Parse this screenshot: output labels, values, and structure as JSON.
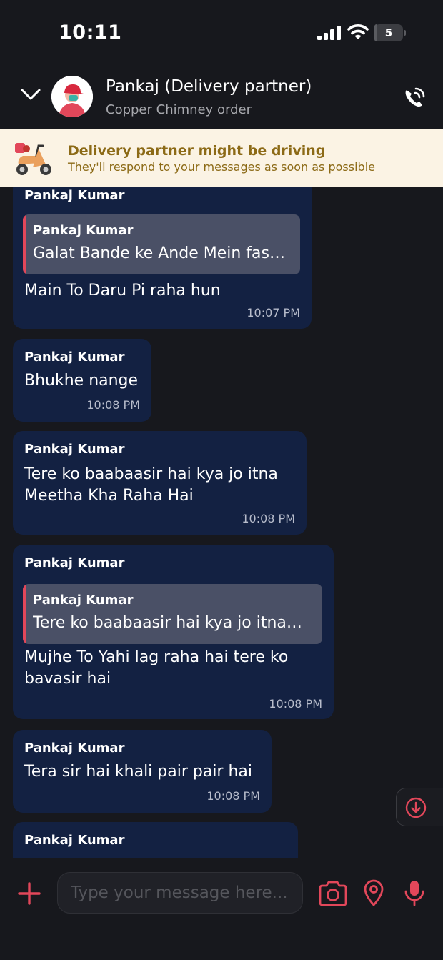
{
  "status_bar": {
    "time": "10:11",
    "battery": "5",
    "battery_level": 0.05
  },
  "header": {
    "contact_name": "Pankaj (Delivery partner)",
    "subtitle": "Copper Chimney order"
  },
  "banner": {
    "title": "Delivery partner might be driving",
    "subtitle": "They'll respond to your messages as soon as possible"
  },
  "messages": [
    {
      "sender": "Pankaj Kumar",
      "quote": {
        "sender": "Pankaj Kumar",
        "text": "Galat Bande ke Ande Mein fas…"
      },
      "text": "Main To Daru Pi raha hun",
      "time": "10:07 PM"
    },
    {
      "sender": "Pankaj Kumar",
      "text": "Bhukhe nange",
      "time": "10:08 PM"
    },
    {
      "sender": "Pankaj Kumar",
      "text": "Tere ko baabaasir hai kya jo itna Meetha Kha Raha Hai",
      "time": "10:08 PM"
    },
    {
      "sender": "Pankaj Kumar",
      "quote": {
        "sender": "Pankaj Kumar",
        "text": "Tere ko baabaasir hai kya jo itna…"
      },
      "text": "Mujhe To Yahi lag raha hai tere ko bavasir hai",
      "time": "10:08 PM"
    },
    {
      "sender": "Pankaj Kumar",
      "text": "Tera sir hai khali pair pair hai",
      "time": "10:08 PM"
    },
    {
      "sender": "Pankaj Kumar",
      "text": "",
      "time": ""
    }
  ],
  "composer": {
    "placeholder": "Type your message here..."
  },
  "colors": {
    "background": "#17181d",
    "bubble": "#132142",
    "quote": "#4a5066",
    "accent_red": "#e2475a",
    "banner_bg": "#fbf3e4",
    "banner_text": "#8c6a16"
  },
  "icons": [
    "signal-icon",
    "wifi-icon",
    "chevron-down-icon",
    "avatar",
    "phone-call-icon",
    "scooter-icon",
    "arrow-down-circle-icon",
    "plus-icon",
    "camera-icon",
    "location-pin-icon",
    "microphone-icon"
  ]
}
